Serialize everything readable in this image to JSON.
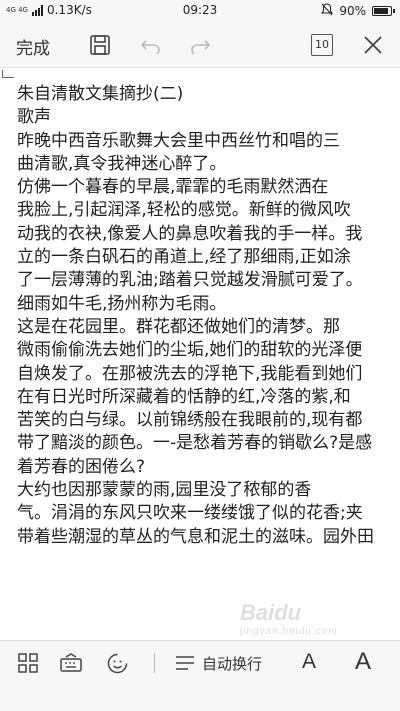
{
  "status_bar": {
    "network_type": "4G 4G",
    "speed": "0.13K/s",
    "time": "09:23",
    "battery": "90%",
    "battery_level": 0.9,
    "icons": [
      "signal-icon",
      "mute-icon",
      "battery-icon"
    ]
  },
  "toolbar": {
    "done_label": "完成",
    "font_size_label": "10",
    "icons": [
      "save-icon",
      "undo-icon",
      "redo-icon",
      "close-icon"
    ]
  },
  "document": {
    "lines": [
      "朱自清散文集摘抄(二)",
      "歌声",
      "昨晚中西音乐歌舞大会里中西丝竹和唱的三",
      "曲清歌,真令我神迷心醉了。",
      "仿佛一个暮春的早晨,霏霏的毛雨默然洒在",
      "我脸上,引起润泽,轻松的感觉。新鲜的微风吹",
      "动我的衣袂,像爱人的鼻息吹着我的手一样。我",
      "立的一条白矾石的甬道上,经了那细雨,正如涂",
      "了一层薄薄的乳油;踏着只觉越发滑腻可爱了。",
      "细雨如牛毛,扬州称为毛雨。",
      "这是在花园里。群花都还做她们的清梦。那",
      "微雨偷偷洗去她们的尘垢,她们的甜软的光泽便",
      "自焕发了。在那被洗去的浮艳下,我能看到她们",
      "在有日光时所深藏着的恬静的红,冷落的紫,和",
      "苦笑的白与绿。以前锦绣般在我眼前的,现有都",
      "带了黯淡的颜色。一-是愁着芳春的销歇么?是感",
      "着芳春的困倦么?",
      "大约也因那蒙蒙的雨,园里没了秾郁的香",
      "气。涓涓的东风只吹来一缕缕饿了似的花香;夹",
      "带着些潮湿的草丛的气息和泥土的滋味。园外田"
    ]
  },
  "bottom_bar": {
    "wrap_label": "自动换行",
    "font_a_label": "A",
    "font_a2_label": "A",
    "icons": [
      "grid-icon",
      "keyboard-icon",
      "emoji-icon",
      "wrap-icon"
    ]
  },
  "watermark": {
    "text": "Baidu",
    "sub": "jingyan.baidu.com"
  },
  "colors": {
    "bar_bg": "#f7f7f7",
    "text": "#222222"
  }
}
